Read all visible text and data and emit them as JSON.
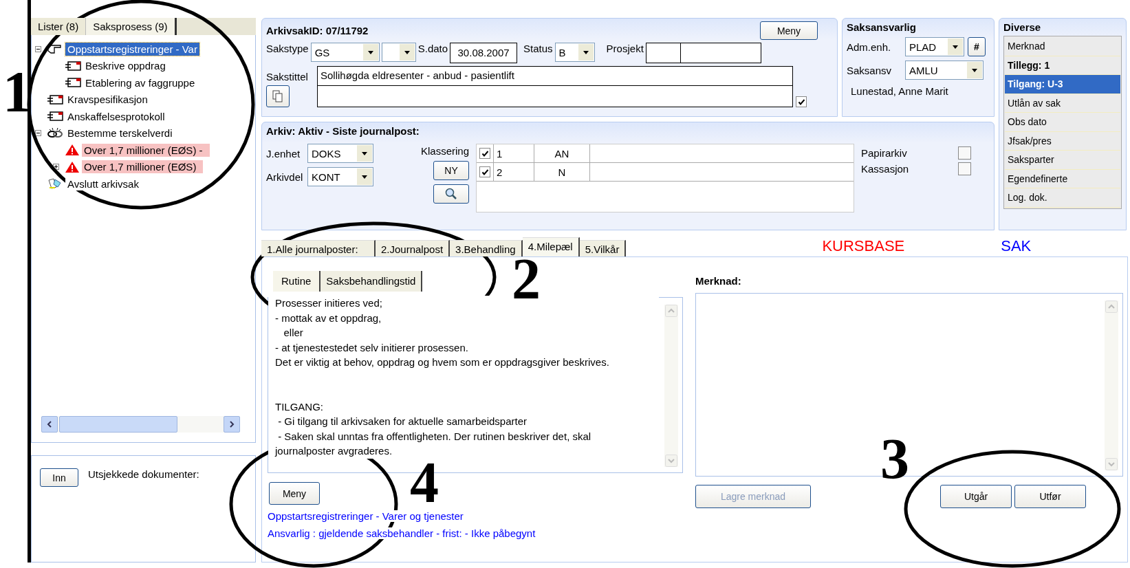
{
  "left_panel": {
    "tabs": [
      {
        "label": "Lister (8)",
        "selected": false
      },
      {
        "label": "Saksprosess (9)",
        "selected": true
      }
    ],
    "tree": [
      {
        "label": "Oppstartsregistreringer -  Var",
        "kind": "pointer",
        "selected": true,
        "highlighted": false,
        "expanded": true,
        "children": [
          {
            "label": "Beskrive oppdrag",
            "kind": "form",
            "selected": false,
            "highlighted": false
          },
          {
            "label": "Etablering av faggruppe",
            "kind": "form",
            "selected": false,
            "highlighted": false
          }
        ]
      },
      {
        "label": "Kravspesifikasjon",
        "kind": "form",
        "selected": false,
        "highlighted": false
      },
      {
        "label": "Anskaffelsesprotokoll",
        "kind": "form",
        "selected": false,
        "highlighted": false
      },
      {
        "label": "Bestemme terskelverdi",
        "kind": "linked",
        "selected": false,
        "highlighted": false,
        "expanded": true,
        "children": [
          {
            "label": "Over 1,7 millioner (EØS) -",
            "kind": "warning",
            "selected": false,
            "highlighted": true
          },
          {
            "label": "Over 1,7 millioner (EØS)",
            "kind": "warning",
            "selected": false,
            "highlighted": true,
            "expanded": false
          }
        ]
      },
      {
        "label": "Avslutt arkivsak",
        "kind": "finish",
        "selected": false,
        "highlighted": false
      }
    ],
    "checkin_button": "Inn",
    "checked_out_label": "Utsjekkede dokumenter:"
  },
  "case": {
    "title": "ArkivsakID: 07/11792",
    "menu_button": "Meny",
    "sakstype": {
      "label": "Sakstype",
      "value": "GS"
    },
    "sdato": {
      "label": "S.dato",
      "value": "30.08.2007"
    },
    "status": {
      "label": "Status",
      "value": "B"
    },
    "prosjekt_label": "Prosjekt",
    "sakstittel": {
      "label": "Sakstittel",
      "value": "Sollihøgda eldresenter - anbud - pasientlift",
      "checked": true
    }
  },
  "responsible": {
    "title": "Saksansvarlig",
    "adm": {
      "label": "Adm.enh.",
      "value": "PLAD"
    },
    "hash_button": "#",
    "resp": {
      "label": "Saksansv",
      "value": "AMLU"
    },
    "name": "Lunestad, Anne Marit"
  },
  "diverse": {
    "title": "Diverse",
    "items": [
      {
        "label": "Merknad",
        "bold": false,
        "selected": false
      },
      {
        "label": "Tillegg: 1",
        "bold": true,
        "selected": false
      },
      {
        "label": "Tilgang: U-3",
        "bold": true,
        "selected": true
      },
      {
        "label": "Utlån av sak",
        "bold": false,
        "selected": false
      },
      {
        "label": "Obs dato",
        "bold": false,
        "selected": false
      },
      {
        "label": "Jfsak/pres",
        "bold": false,
        "selected": false
      },
      {
        "label": "Saksparter",
        "bold": false,
        "selected": false
      },
      {
        "label": "Egendefinerte",
        "bold": false,
        "selected": false
      },
      {
        "label": "Log. dok.",
        "bold": false,
        "selected": false
      }
    ]
  },
  "archive": {
    "title": "Arkiv: Aktiv - Siste journalpost:",
    "j_enhet": {
      "label": "J.enhet",
      "value": "DOKS"
    },
    "arkivdel": {
      "label": "Arkivdel",
      "value": "KONT"
    },
    "klassering_label": "Klassering",
    "new_button": "NY",
    "classes": [
      {
        "checked": true,
        "number": "1",
        "code": "AN"
      },
      {
        "checked": true,
        "number": "2",
        "code": "N"
      }
    ],
    "flags": [
      {
        "label": "Papirarkiv",
        "checked": false
      },
      {
        "label": "Kassasjon",
        "checked": false
      }
    ]
  },
  "tabs": [
    {
      "label": "1.Alle journalposter:",
      "selected": false
    },
    {
      "label": "2.Journalpost",
      "selected": false
    },
    {
      "label": "3.Behandling",
      "selected": false
    },
    {
      "label": "4.Milepæl",
      "selected": true
    },
    {
      "label": "5.Vilkår",
      "selected": false
    }
  ],
  "banner": {
    "left": "KURSBASE",
    "right": "SAK"
  },
  "milestone": {
    "subtabs": [
      {
        "label": "Rutine",
        "selected": true
      },
      {
        "label": "Saksbehandlingstid",
        "selected": false
      }
    ],
    "routine_text": "Prosesser initieres ved;\n- mottak av et oppdrag,\n   eller\n- at tjenestestedet selv initierer prosessen.\nDet er viktig at behov, oppdrag og hvem som er oppdragsgiver beskrives.\n\n\nTILGANG:\n - Gi tilgang til arkivsaken for aktuelle samarbeidsparter\n - Saken skal unntas fra offentligheten. Der rutinen beskriver det, skal\njournalposter avgraderes.",
    "menu_button": "Meny",
    "links": [
      "Oppstartsregistreringer - Varer og tjenester",
      "Ansvarlig : gjeldende saksbehandler  - frist: - Ikke påbegynt"
    ],
    "remark_label": "Merknad:",
    "save_button": {
      "label": "Lagre merknad",
      "disabled": true
    },
    "actions": [
      "Utgår",
      "Utfør"
    ]
  },
  "annotations": [
    {
      "label": "1"
    },
    {
      "label": "2"
    },
    {
      "label": "3"
    },
    {
      "label": "4"
    }
  ]
}
